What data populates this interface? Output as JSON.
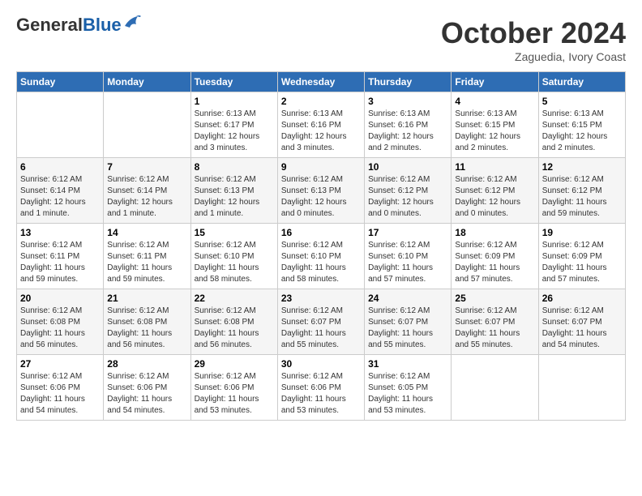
{
  "header": {
    "logo_general": "General",
    "logo_blue": "Blue",
    "month_year": "October 2024",
    "location": "Zaguedia, Ivory Coast"
  },
  "weekdays": [
    "Sunday",
    "Monday",
    "Tuesday",
    "Wednesday",
    "Thursday",
    "Friday",
    "Saturday"
  ],
  "weeks": [
    [
      {
        "day": "",
        "sunrise": "",
        "sunset": "",
        "daylight": ""
      },
      {
        "day": "",
        "sunrise": "",
        "sunset": "",
        "daylight": ""
      },
      {
        "day": "1",
        "sunrise": "Sunrise: 6:13 AM",
        "sunset": "Sunset: 6:17 PM",
        "daylight": "Daylight: 12 hours and 3 minutes."
      },
      {
        "day": "2",
        "sunrise": "Sunrise: 6:13 AM",
        "sunset": "Sunset: 6:16 PM",
        "daylight": "Daylight: 12 hours and 3 minutes."
      },
      {
        "day": "3",
        "sunrise": "Sunrise: 6:13 AM",
        "sunset": "Sunset: 6:16 PM",
        "daylight": "Daylight: 12 hours and 2 minutes."
      },
      {
        "day": "4",
        "sunrise": "Sunrise: 6:13 AM",
        "sunset": "Sunset: 6:15 PM",
        "daylight": "Daylight: 12 hours and 2 minutes."
      },
      {
        "day": "5",
        "sunrise": "Sunrise: 6:13 AM",
        "sunset": "Sunset: 6:15 PM",
        "daylight": "Daylight: 12 hours and 2 minutes."
      }
    ],
    [
      {
        "day": "6",
        "sunrise": "Sunrise: 6:12 AM",
        "sunset": "Sunset: 6:14 PM",
        "daylight": "Daylight: 12 hours and 1 minute."
      },
      {
        "day": "7",
        "sunrise": "Sunrise: 6:12 AM",
        "sunset": "Sunset: 6:14 PM",
        "daylight": "Daylight: 12 hours and 1 minute."
      },
      {
        "day": "8",
        "sunrise": "Sunrise: 6:12 AM",
        "sunset": "Sunset: 6:13 PM",
        "daylight": "Daylight: 12 hours and 1 minute."
      },
      {
        "day": "9",
        "sunrise": "Sunrise: 6:12 AM",
        "sunset": "Sunset: 6:13 PM",
        "daylight": "Daylight: 12 hours and 0 minutes."
      },
      {
        "day": "10",
        "sunrise": "Sunrise: 6:12 AM",
        "sunset": "Sunset: 6:12 PM",
        "daylight": "Daylight: 12 hours and 0 minutes."
      },
      {
        "day": "11",
        "sunrise": "Sunrise: 6:12 AM",
        "sunset": "Sunset: 6:12 PM",
        "daylight": "Daylight: 12 hours and 0 minutes."
      },
      {
        "day": "12",
        "sunrise": "Sunrise: 6:12 AM",
        "sunset": "Sunset: 6:12 PM",
        "daylight": "Daylight: 11 hours and 59 minutes."
      }
    ],
    [
      {
        "day": "13",
        "sunrise": "Sunrise: 6:12 AM",
        "sunset": "Sunset: 6:11 PM",
        "daylight": "Daylight: 11 hours and 59 minutes."
      },
      {
        "day": "14",
        "sunrise": "Sunrise: 6:12 AM",
        "sunset": "Sunset: 6:11 PM",
        "daylight": "Daylight: 11 hours and 59 minutes."
      },
      {
        "day": "15",
        "sunrise": "Sunrise: 6:12 AM",
        "sunset": "Sunset: 6:10 PM",
        "daylight": "Daylight: 11 hours and 58 minutes."
      },
      {
        "day": "16",
        "sunrise": "Sunrise: 6:12 AM",
        "sunset": "Sunset: 6:10 PM",
        "daylight": "Daylight: 11 hours and 58 minutes."
      },
      {
        "day": "17",
        "sunrise": "Sunrise: 6:12 AM",
        "sunset": "Sunset: 6:10 PM",
        "daylight": "Daylight: 11 hours and 57 minutes."
      },
      {
        "day": "18",
        "sunrise": "Sunrise: 6:12 AM",
        "sunset": "Sunset: 6:09 PM",
        "daylight": "Daylight: 11 hours and 57 minutes."
      },
      {
        "day": "19",
        "sunrise": "Sunrise: 6:12 AM",
        "sunset": "Sunset: 6:09 PM",
        "daylight": "Daylight: 11 hours and 57 minutes."
      }
    ],
    [
      {
        "day": "20",
        "sunrise": "Sunrise: 6:12 AM",
        "sunset": "Sunset: 6:08 PM",
        "daylight": "Daylight: 11 hours and 56 minutes."
      },
      {
        "day": "21",
        "sunrise": "Sunrise: 6:12 AM",
        "sunset": "Sunset: 6:08 PM",
        "daylight": "Daylight: 11 hours and 56 minutes."
      },
      {
        "day": "22",
        "sunrise": "Sunrise: 6:12 AM",
        "sunset": "Sunset: 6:08 PM",
        "daylight": "Daylight: 11 hours and 56 minutes."
      },
      {
        "day": "23",
        "sunrise": "Sunrise: 6:12 AM",
        "sunset": "Sunset: 6:07 PM",
        "daylight": "Daylight: 11 hours and 55 minutes."
      },
      {
        "day": "24",
        "sunrise": "Sunrise: 6:12 AM",
        "sunset": "Sunset: 6:07 PM",
        "daylight": "Daylight: 11 hours and 55 minutes."
      },
      {
        "day": "25",
        "sunrise": "Sunrise: 6:12 AM",
        "sunset": "Sunset: 6:07 PM",
        "daylight": "Daylight: 11 hours and 55 minutes."
      },
      {
        "day": "26",
        "sunrise": "Sunrise: 6:12 AM",
        "sunset": "Sunset: 6:07 PM",
        "daylight": "Daylight: 11 hours and 54 minutes."
      }
    ],
    [
      {
        "day": "27",
        "sunrise": "Sunrise: 6:12 AM",
        "sunset": "Sunset: 6:06 PM",
        "daylight": "Daylight: 11 hours and 54 minutes."
      },
      {
        "day": "28",
        "sunrise": "Sunrise: 6:12 AM",
        "sunset": "Sunset: 6:06 PM",
        "daylight": "Daylight: 11 hours and 54 minutes."
      },
      {
        "day": "29",
        "sunrise": "Sunrise: 6:12 AM",
        "sunset": "Sunset: 6:06 PM",
        "daylight": "Daylight: 11 hours and 53 minutes."
      },
      {
        "day": "30",
        "sunrise": "Sunrise: 6:12 AM",
        "sunset": "Sunset: 6:06 PM",
        "daylight": "Daylight: 11 hours and 53 minutes."
      },
      {
        "day": "31",
        "sunrise": "Sunrise: 6:12 AM",
        "sunset": "Sunset: 6:05 PM",
        "daylight": "Daylight: 11 hours and 53 minutes."
      },
      {
        "day": "",
        "sunrise": "",
        "sunset": "",
        "daylight": ""
      },
      {
        "day": "",
        "sunrise": "",
        "sunset": "",
        "daylight": ""
      }
    ]
  ]
}
